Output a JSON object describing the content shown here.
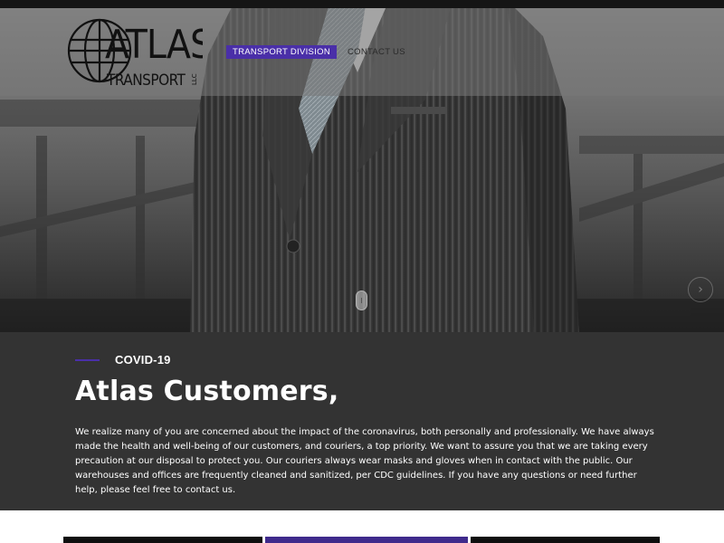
{
  "brand": {
    "name_top": "ATLAS",
    "name_bottom": "TRANSPORT",
    "suffix": "LLC",
    "accent_color": "#4a2fa8"
  },
  "nav": {
    "items": [
      {
        "label": "TRANSPORT DIVISION",
        "active": true
      },
      {
        "label": "CONTACT US",
        "active": false
      }
    ]
  },
  "hero": {
    "image": "man-in-pinstripe-suit"
  },
  "notice": {
    "eyebrow": "COVID-19",
    "headline": "Atlas Customers,",
    "body": "We realize many of you are concerned about the impact of the coronavirus, both personally and professionally. We have always made the health and well-being of our customers, and couriers, a top priority. We want to assure you that we are taking every precaution at our disposal to protect you. Our couriers always wear masks and gloves when in contact with the public. Our warehouses and offices are frequently cleaned and sanitized, per CDC guidelines. If you have any questions or need further help, please feel free to contact us."
  }
}
